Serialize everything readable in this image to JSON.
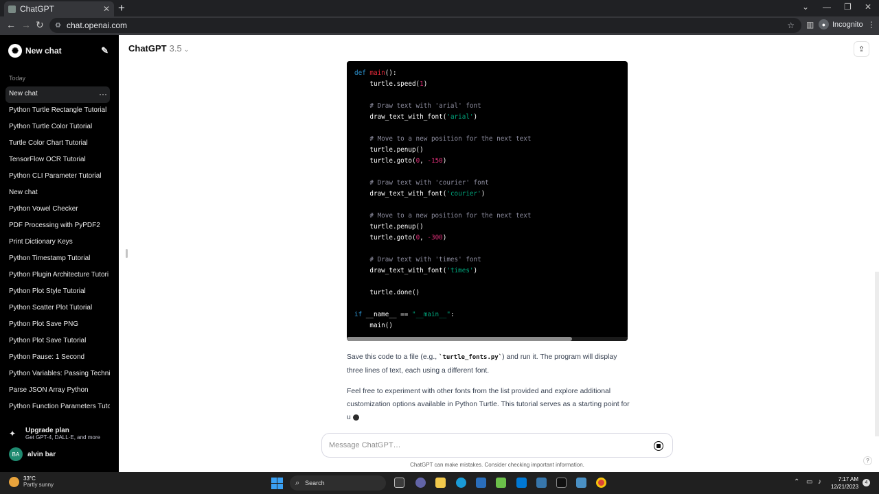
{
  "browser": {
    "tab_title": "ChatGPT",
    "url": "chat.openai.com",
    "incognito_label": "Incognito"
  },
  "sidebar": {
    "new_chat_label": "New chat",
    "section_today": "Today",
    "items": [
      {
        "label": "New chat",
        "active": true
      },
      {
        "label": "Python Turtle Rectangle Tutorial"
      },
      {
        "label": "Python Turtle Color Tutorial"
      },
      {
        "label": "Turtle Color Chart Tutorial"
      },
      {
        "label": "TensorFlow OCR Tutorial"
      },
      {
        "label": "Python CLI Parameter Tutorial"
      },
      {
        "label": "New chat"
      },
      {
        "label": "Python Vowel Checker"
      },
      {
        "label": "PDF Processing with PyPDF2"
      },
      {
        "label": "Print Dictionary Keys"
      },
      {
        "label": "Python Timestamp Tutorial"
      },
      {
        "label": "Python Plugin Architecture Tutori"
      },
      {
        "label": "Python Plot Style Tutorial"
      },
      {
        "label": "Python Scatter Plot Tutorial"
      },
      {
        "label": "Python Plot Save PNG"
      },
      {
        "label": "Python Plot Save Tutorial"
      },
      {
        "label": "Python Pause: 1 Second"
      },
      {
        "label": "Python Variables: Passing Techni"
      },
      {
        "label": "Parse JSON Array Python"
      },
      {
        "label": "Python Function Parameters Tuto"
      }
    ],
    "upgrade_title": "Upgrade plan",
    "upgrade_subtitle": "Get GPT-4, DALL·E, and more",
    "user_initials": "BA",
    "user_name": "alvin bar"
  },
  "header": {
    "model": "ChatGPT",
    "version": "3.5"
  },
  "code_lines": [
    [
      [
        "kw",
        "def "
      ],
      [
        "fn",
        "main"
      ],
      [
        "p",
        "():"
      ]
    ],
    [
      [
        "p",
        "    turtle.speed("
      ],
      [
        "num",
        "1"
      ],
      [
        "p",
        ")"
      ]
    ],
    [],
    [
      [
        "com",
        "    # Draw text with 'arial' font"
      ]
    ],
    [
      [
        "p",
        "    draw_text_with_font("
      ],
      [
        "str",
        "'arial'"
      ],
      [
        "p",
        ")"
      ]
    ],
    [],
    [
      [
        "com",
        "    # Move to a new position for the next text"
      ]
    ],
    [
      [
        "p",
        "    turtle.penup()"
      ]
    ],
    [
      [
        "p",
        "    turtle.goto("
      ],
      [
        "num",
        "0"
      ],
      [
        "p",
        ", "
      ],
      [
        "num",
        "-150"
      ],
      [
        "p",
        ")"
      ]
    ],
    [],
    [
      [
        "com",
        "    # Draw text with 'courier' font"
      ]
    ],
    [
      [
        "p",
        "    draw_text_with_font("
      ],
      [
        "str",
        "'courier'"
      ],
      [
        "p",
        ")"
      ]
    ],
    [],
    [
      [
        "com",
        "    # Move to a new position for the next text"
      ]
    ],
    [
      [
        "p",
        "    turtle.penup()"
      ]
    ],
    [
      [
        "p",
        "    turtle.goto("
      ],
      [
        "num",
        "0"
      ],
      [
        "p",
        ", "
      ],
      [
        "num",
        "-300"
      ],
      [
        "p",
        ")"
      ]
    ],
    [],
    [
      [
        "com",
        "    # Draw text with 'times' font"
      ]
    ],
    [
      [
        "p",
        "    draw_text_with_font("
      ],
      [
        "str",
        "'times'"
      ],
      [
        "p",
        ")"
      ]
    ],
    [],
    [
      [
        "p",
        "    turtle.done()"
      ]
    ],
    [],
    [
      [
        "kw",
        "if "
      ],
      [
        "p",
        "__name__ == "
      ],
      [
        "str",
        "\"__main__\""
      ],
      [
        "p",
        ":"
      ]
    ],
    [
      [
        "p",
        "    main()"
      ]
    ]
  ],
  "message": {
    "para1_before": "Save this code to a file (e.g., ",
    "para1_code": "`turtle_fonts.py`",
    "para1_after": ") and run it. The program will display three lines of text, each using a different font.",
    "para2": "Feel free to experiment with other fonts from the list provided and explore additional customization options available in Python Turtle. This tutorial serves as a starting point for u"
  },
  "composer": {
    "placeholder": "Message ChatGPT…",
    "disclaimer": "ChatGPT can make mistakes. Consider checking important information."
  },
  "taskbar": {
    "temp": "33°C",
    "condition": "Partly sunny",
    "search_label": "Search",
    "time": "7:17 AM",
    "date": "12/21/2023",
    "notifications": "4"
  }
}
